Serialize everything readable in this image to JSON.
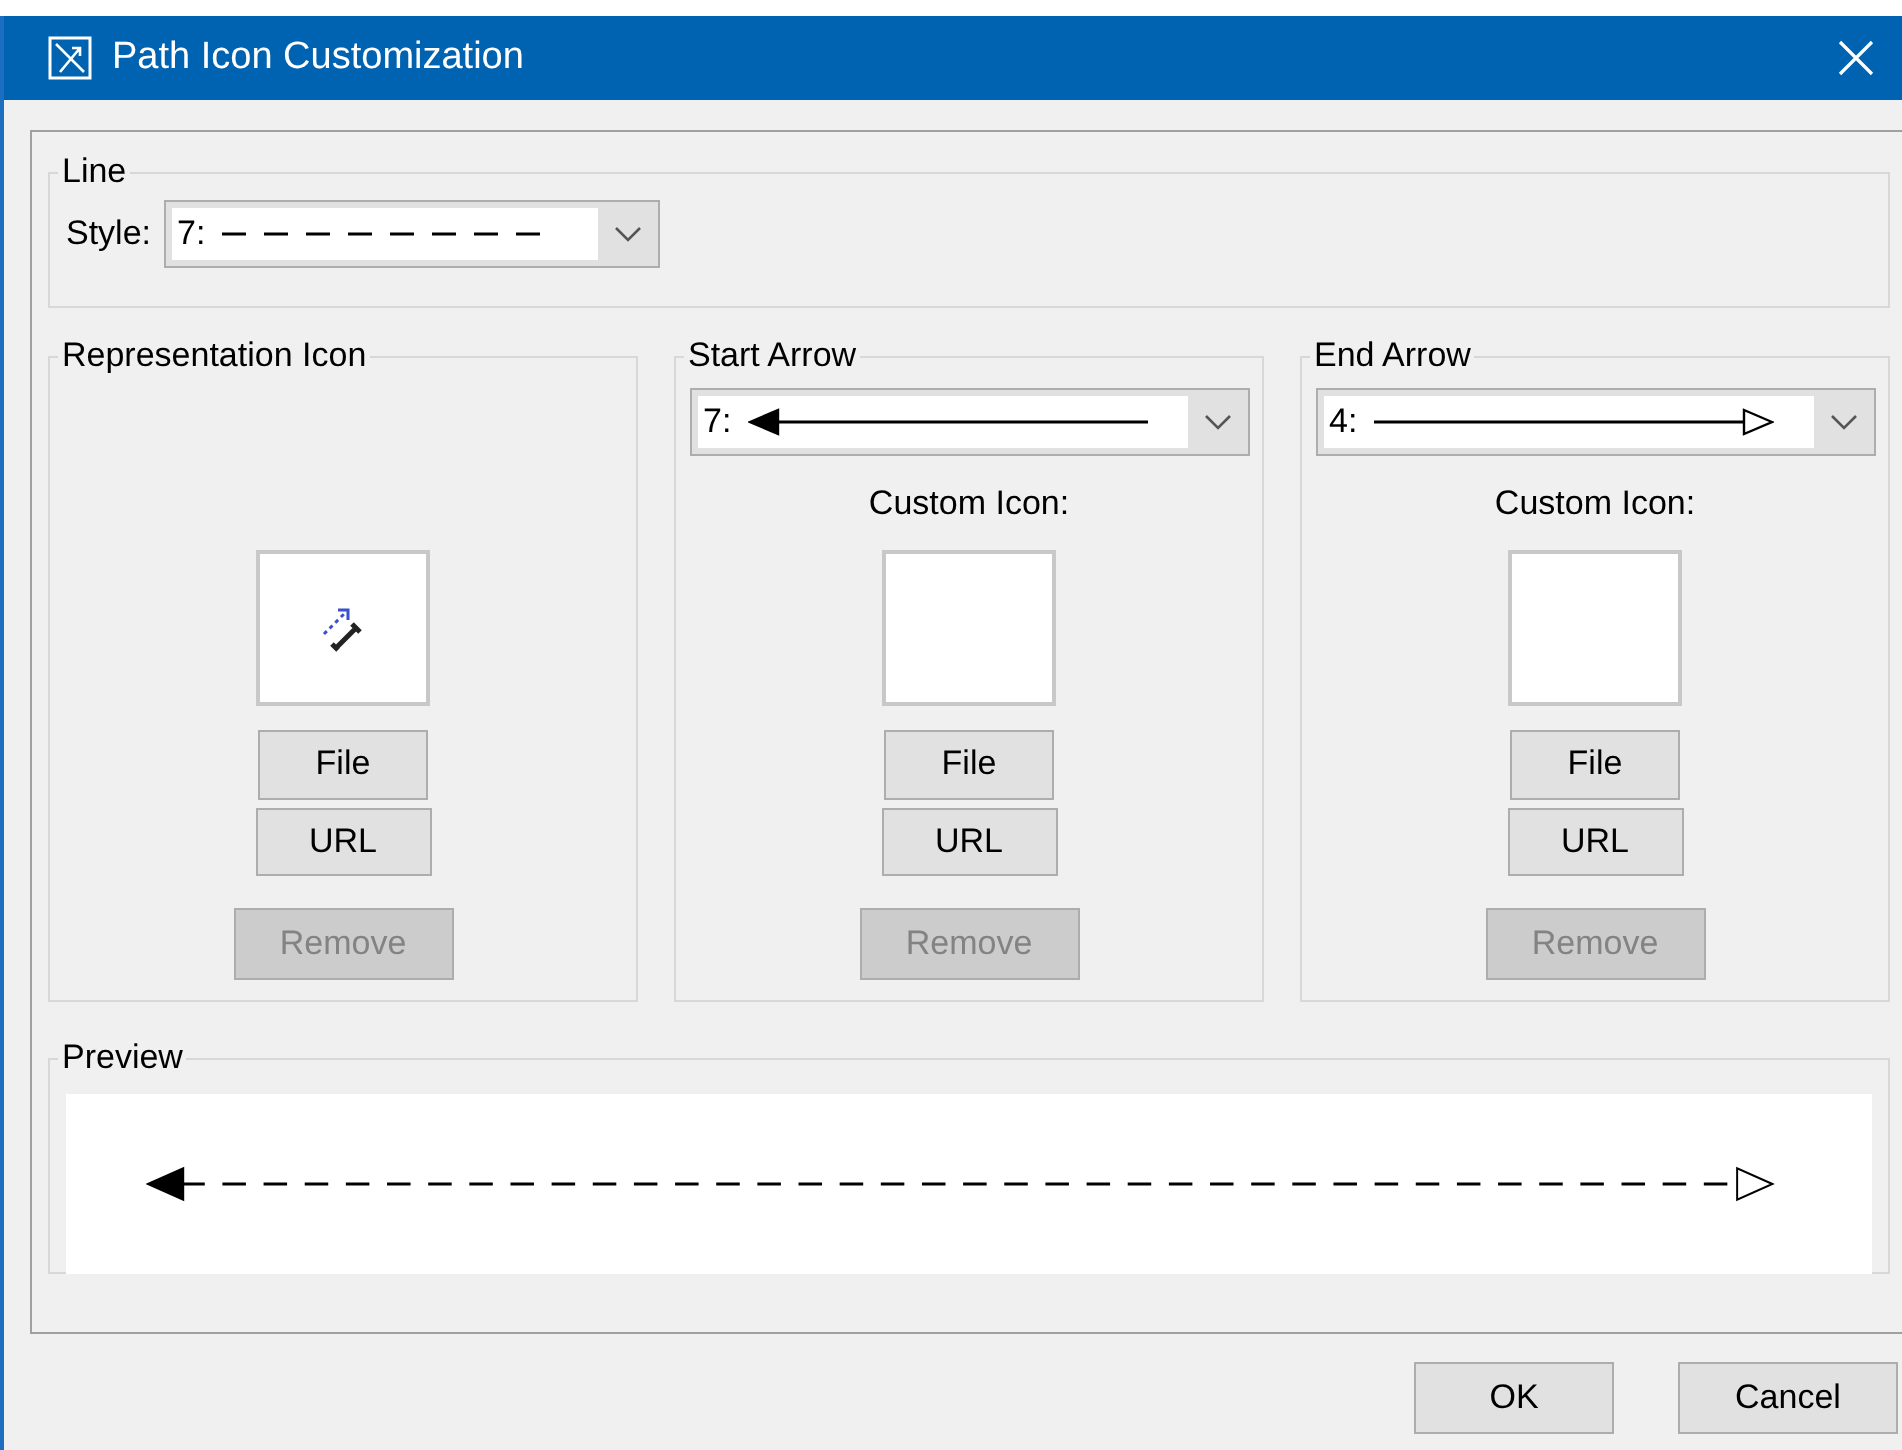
{
  "window": {
    "title": "Path Icon Customization"
  },
  "line": {
    "legend": "Line",
    "style_label": "Style:",
    "style_value": "7:",
    "dashed": true
  },
  "sections": [
    {
      "kind": "representation",
      "legend": "Representation Icon",
      "buttons": [
        {
          "label": "File",
          "disabled": false
        },
        {
          "label": "URL",
          "disabled": false
        },
        {
          "label": "Remove",
          "disabled": true
        }
      ]
    },
    {
      "kind": "start_arrow",
      "legend": "Start Arrow",
      "value": "7:",
      "filled_head": true,
      "custom_label": "Custom Icon:",
      "buttons": [
        {
          "label": "File",
          "disabled": false
        },
        {
          "label": "URL",
          "disabled": false
        },
        {
          "label": "Remove",
          "disabled": true
        }
      ]
    },
    {
      "kind": "end_arrow",
      "legend": "End Arrow",
      "value": "4:",
      "filled_head": false,
      "custom_label": "Custom Icon:",
      "buttons": [
        {
          "label": "File",
          "disabled": false
        },
        {
          "label": "URL",
          "disabled": false
        },
        {
          "label": "Remove",
          "disabled": true
        }
      ]
    }
  ],
  "preview": {
    "legend": "Preview"
  },
  "buttons": [
    {
      "label": "OK"
    },
    {
      "label": "Cancel"
    }
  ]
}
